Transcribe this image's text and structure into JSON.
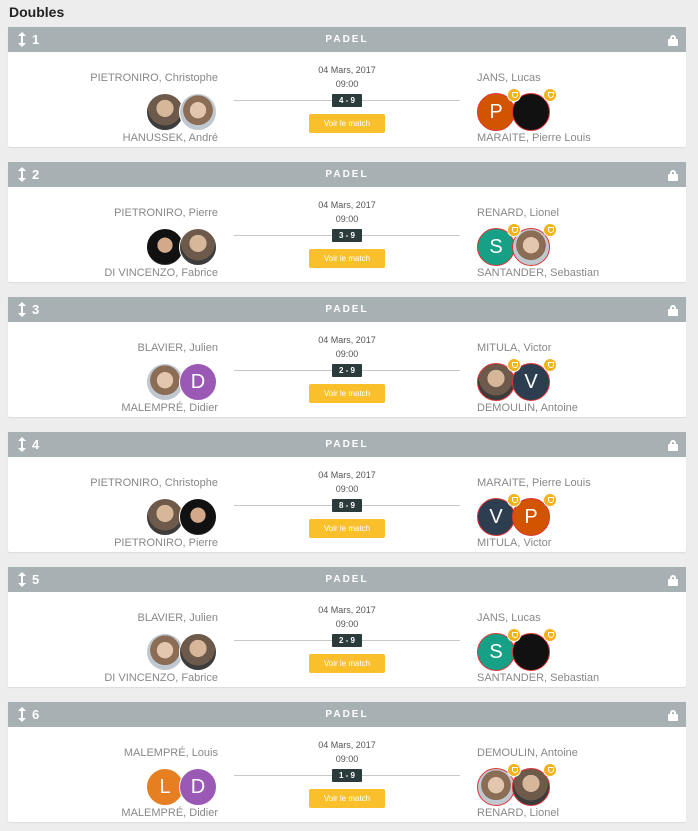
{
  "section_title": "Doubles",
  "matches": [
    {
      "num": "1",
      "sport": "PADEL",
      "date": "04 Mars, 2017",
      "time": "09:00",
      "score": "4 - 9",
      "button": "Voir le match",
      "left_top": "PIETRONIRO, Christophe",
      "left_bot": "HANUSSEK, André",
      "right_top": "JANS, Lucas",
      "right_bot": "MARAITE, Pierre Louis",
      "left_av": [
        {
          "type": "photo",
          "letter": ""
        },
        {
          "type": "photo2",
          "letter": ""
        }
      ],
      "right_av": [
        {
          "type": "letter",
          "letter": "P",
          "color": "#d35400"
        },
        {
          "type": "letter",
          "letter": "",
          "color": "#111"
        }
      ]
    },
    {
      "num": "2",
      "sport": "PADEL",
      "date": "04 Mars, 2017",
      "time": "09:00",
      "score": "3 - 9",
      "button": "Voir le match",
      "left_top": "PIETRONIRO, Pierre",
      "left_bot": "DI VINCENZO, Fabrice",
      "right_top": "RENARD, Lionel",
      "right_bot": "SANTANDER, Sebastian",
      "left_av": [
        {
          "type": "photo3",
          "letter": ""
        },
        {
          "type": "photo",
          "letter": ""
        }
      ],
      "right_av": [
        {
          "type": "letter",
          "letter": "S",
          "color": "#16a085"
        },
        {
          "type": "photo2",
          "letter": ""
        }
      ]
    },
    {
      "num": "3",
      "sport": "PADEL",
      "date": "04 Mars, 2017",
      "time": "09:00",
      "score": "2 - 9",
      "button": "Voir le match",
      "left_top": "BLAVIER, Julien",
      "left_bot": "MALEMPRÉ, Didier",
      "right_top": "MITULA, Victor",
      "right_bot": "DEMOULIN, Antoine",
      "left_av": [
        {
          "type": "photo2",
          "letter": ""
        },
        {
          "type": "letter",
          "letter": "D",
          "color": "#9b59b6"
        }
      ],
      "right_av": [
        {
          "type": "photo",
          "letter": ""
        },
        {
          "type": "letter",
          "letter": "V",
          "color": "#2c3e50"
        }
      ]
    },
    {
      "num": "4",
      "sport": "PADEL",
      "date": "04 Mars, 2017",
      "time": "09:00",
      "score": "8 - 9",
      "button": "Voir le match",
      "left_top": "PIETRONIRO, Christophe",
      "left_bot": "PIETRONIRO, Pierre",
      "right_top": "MARAITE, Pierre Louis",
      "right_bot": "MITULA, Victor",
      "left_av": [
        {
          "type": "photo",
          "letter": ""
        },
        {
          "type": "photo3",
          "letter": ""
        }
      ],
      "right_av": [
        {
          "type": "letter",
          "letter": "V",
          "color": "#2c3e50"
        },
        {
          "type": "letter",
          "letter": "P",
          "color": "#d35400"
        }
      ]
    },
    {
      "num": "5",
      "sport": "PADEL",
      "date": "04 Mars, 2017",
      "time": "09:00",
      "score": "2 - 9",
      "button": "Voir le match",
      "left_top": "BLAVIER, Julien",
      "left_bot": "DI VINCENZO, Fabrice",
      "right_top": "JANS, Lucas",
      "right_bot": "SANTANDER, Sebastian",
      "left_av": [
        {
          "type": "photo2",
          "letter": ""
        },
        {
          "type": "photo",
          "letter": ""
        }
      ],
      "right_av": [
        {
          "type": "letter",
          "letter": "S",
          "color": "#16a085"
        },
        {
          "type": "letter",
          "letter": "",
          "color": "#111"
        }
      ]
    },
    {
      "num": "6",
      "sport": "PADEL",
      "date": "04 Mars, 2017",
      "time": "09:00",
      "score": "1 - 9",
      "button": "Voir le match",
      "left_top": "MALEMPRÉ, Louis",
      "left_bot": "MALEMPRÉ, Didier",
      "right_top": "DEMOULIN, Antoine",
      "right_bot": "RENARD, Lionel",
      "left_av": [
        {
          "type": "letter",
          "letter": "L",
          "color": "#e67e22"
        },
        {
          "type": "letter",
          "letter": "D",
          "color": "#9b59b6"
        }
      ],
      "right_av": [
        {
          "type": "photo2",
          "letter": ""
        },
        {
          "type": "photo",
          "letter": ""
        }
      ]
    }
  ]
}
